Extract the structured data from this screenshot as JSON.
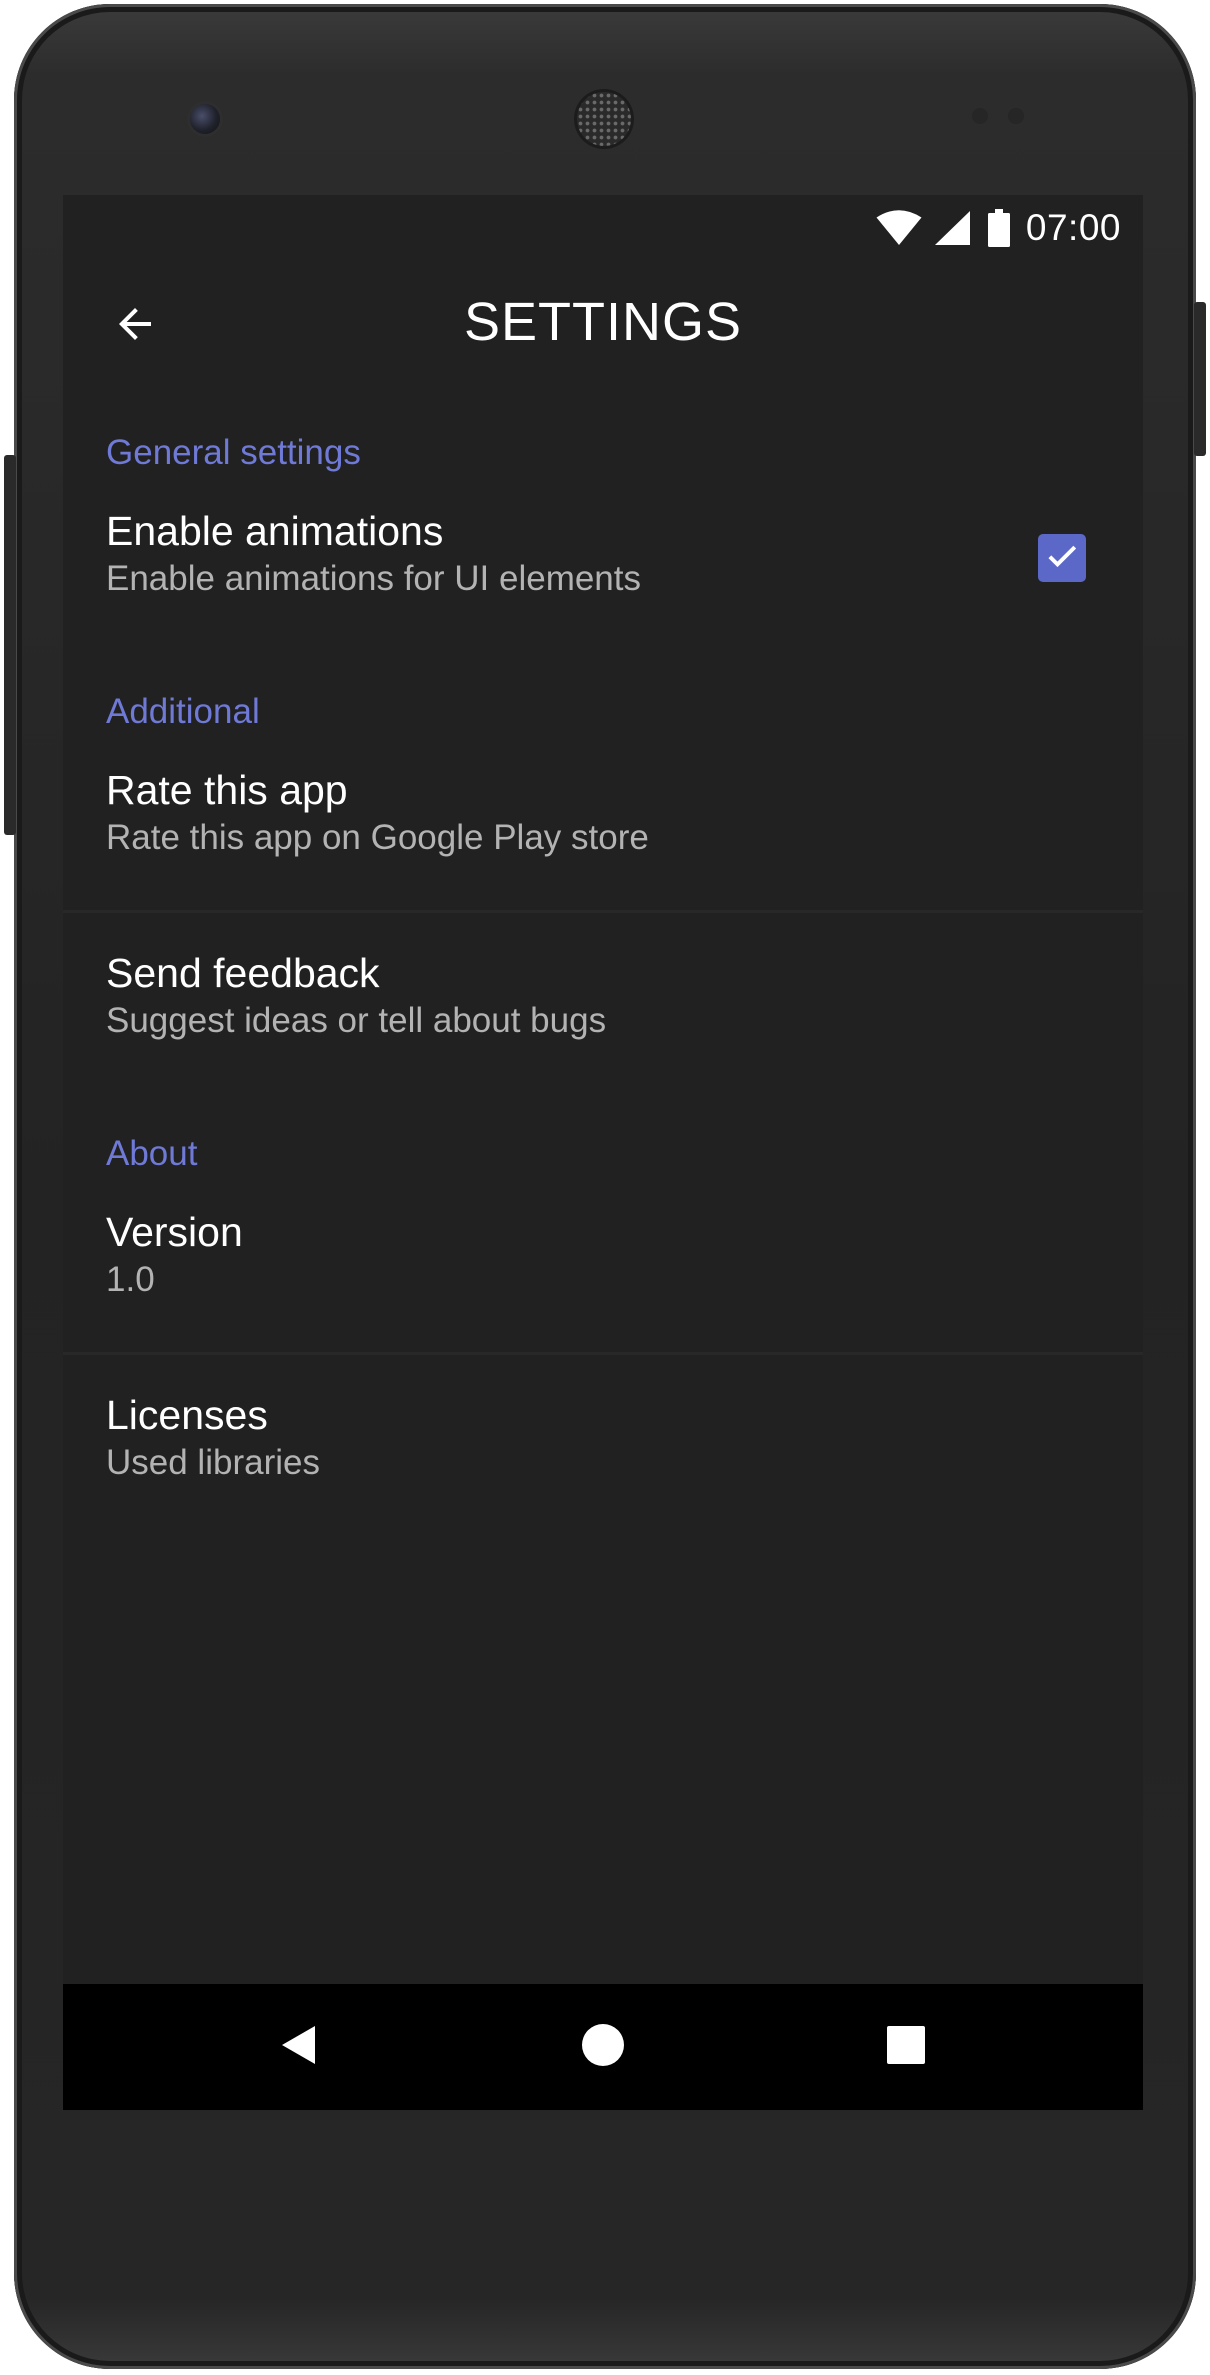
{
  "status_bar": {
    "time": "07:00",
    "icons": [
      "wifi-icon",
      "cell-signal-icon",
      "battery-icon"
    ]
  },
  "app_bar": {
    "title": "SETTINGS",
    "back_icon": "arrow-back-icon"
  },
  "sections": {
    "general": {
      "header": "General settings",
      "enable_animations": {
        "title": "Enable animations",
        "summary": "Enable animations for UI elements",
        "checked": true
      }
    },
    "additional": {
      "header": "Additional",
      "rate_app": {
        "title": "Rate this app",
        "summary": "Rate this app on Google Play store"
      },
      "send_feedback": {
        "title": "Send feedback",
        "summary": "Suggest ideas or tell about bugs"
      }
    },
    "about": {
      "header": "About",
      "version": {
        "title": "Version",
        "summary": "1.0"
      },
      "licenses": {
        "title": "Licenses",
        "summary": "Used libraries"
      }
    }
  },
  "nav_bar": {
    "icons": [
      "nav-back-icon",
      "nav-home-icon",
      "nav-recents-icon"
    ]
  },
  "colors": {
    "accent": "#6f79d6",
    "checkbox": "#5c68c7",
    "background": "#212121",
    "text_primary": "#ffffff",
    "text_secondary": "#b3b3b3",
    "nav_bar": "#000000"
  }
}
